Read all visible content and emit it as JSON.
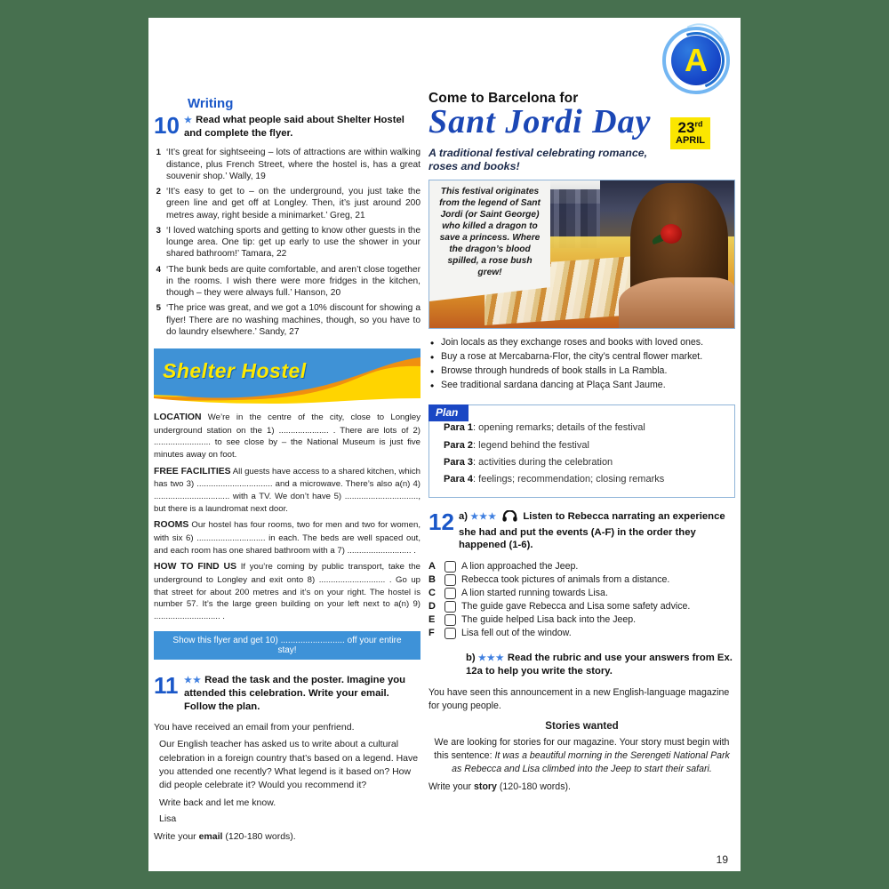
{
  "page": {
    "number": "19",
    "badge_letter": "A"
  },
  "left": {
    "section_title": "Writing",
    "ex10": {
      "number": "10",
      "stars": "★",
      "instruction": "Read what people said about Shelter Hostel and complete the flyer.",
      "items": [
        {
          "n": "1",
          "text": "‘It’s great for sightseeing – lots of attractions are within walking distance, plus French Street, where the hostel is, has a great souvenir shop.’ Wally, 19"
        },
        {
          "n": "2",
          "text": "‘It’s easy to get to – on the underground, you just take the green line and get off at Longley. Then, it’s just around 200 metres away, right beside a minimarket.’ Greg, 21"
        },
        {
          "n": "3",
          "text": "‘I loved watching sports and getting to know other guests in the lounge area. One tip: get up early to use the shower in your shared bathroom!’ Tamara, 22"
        },
        {
          "n": "4",
          "text": "‘The bunk beds are quite comfortable, and aren’t close together in the rooms. I wish there were more fridges in the kitchen, though – they were always full.’ Hanson, 20"
        },
        {
          "n": "5",
          "text": "‘The price was great, and we got a 10% discount for showing a flyer! There are no washing machines, though, so you have to do laundry elsewhere.’ Sandy, 27"
        }
      ]
    },
    "flyer": {
      "title": "Shelter Hostel",
      "location_label": "LOCATION",
      "location_text": "We’re in the centre of the city, close to Longley underground station on the 1) ..................... . There are lots of 2) ........................ to see close by – the National Museum is just five minutes away on foot.",
      "facilities_label": "FREE FACILITIES",
      "facilities_text": "All guests have access to a shared kitchen, which has two 3) ................................ and a microwave. There’s also a(n) 4) ................................ with a TV. We don’t have 5) ..............................., but there is a laundromat next door.",
      "rooms_label": "ROOMS",
      "rooms_text": "Our hostel has four rooms, two for men and two for women, with six 6) ............................. in each. The beds are well spaced out, and each room has one shared bathroom with a 7) ........................... .",
      "find_label": "HOW TO FIND US",
      "find_text": "If you’re coming by public transport, take the underground to Longley and exit onto 8) ............................ . Go up that street for about 200 metres and it’s on your right. The hostel is number 57. It’s the large green building on your left next to a(n) 9) ............................ .",
      "banner": "Show this flyer and get 10) .......................... off your entire stay!"
    },
    "ex11": {
      "number": "11",
      "stars": "★★",
      "instruction": "Read the task and the poster. Imagine you attended this celebration. Write your email. Follow the plan.",
      "intro": "You have received an email from your penfriend.",
      "body": "Our English teacher has asked us to write about a cultural celebration in a foreign country that’s based on a legend. Have you attended one recently? What legend is it based on? How did people celebrate it? Would you recommend it?",
      "signoff": "Write back and let me know.",
      "name": "Lisa",
      "task_pre": "Write your ",
      "task_bold": "email",
      "task_post": " (120-180 words)."
    }
  },
  "right": {
    "poster": {
      "kicker": "Come to Barcelona for",
      "title": "Sant Jordi Day",
      "date_day": "23",
      "date_suffix": "rd",
      "date_month": "APRIL",
      "subtitle": "A traditional festival celebrating romance, roses and books!",
      "caption": "This festival originates from the legend of Sant Jordi (or Saint George) who killed a dragon to save a princess. Where the dragon’s blood spilled, a rose bush grew!",
      "bullets": [
        "Join locals as they exchange roses and books with loved ones.",
        "Buy a rose at Mercabarna-Flor, the city’s central flower market.",
        "Browse through hundreds of book stalls in La Rambla.",
        "See traditional sardana dancing at Plaça Sant Jaume."
      ]
    },
    "plan": {
      "tab": "Plan",
      "rows": [
        {
          "label": "Para 1",
          "text": ": opening remarks; details of the festival"
        },
        {
          "label": "Para 2",
          "text": ": legend behind the festival"
        },
        {
          "label": "Para 3",
          "text": ": activities during the celebration"
        },
        {
          "label": "Para 4",
          "text": ": feelings; recommendation; closing remarks"
        }
      ]
    },
    "ex12": {
      "number": "12",
      "part_a_label": "a)",
      "stars_a": "★★★",
      "instruction_a": "Listen to Rebecca narrating an experience she had and put the events (A-F) in the order they happened (1-6).",
      "options": [
        {
          "letter": "A",
          "text": "A lion approached the Jeep."
        },
        {
          "letter": "B",
          "text": "Rebecca took pictures of animals from a distance."
        },
        {
          "letter": "C",
          "text": "A lion started running towards Lisa."
        },
        {
          "letter": "D",
          "text": "The guide gave Rebecca and Lisa some safety advice."
        },
        {
          "letter": "E",
          "text": "The guide helped Lisa back into the Jeep."
        },
        {
          "letter": "F",
          "text": "Lisa fell out of the window."
        }
      ],
      "part_b_label": "b)",
      "stars_b": "★★★",
      "instruction_b": "Read the rubric and use your answers from Ex. 12a to help you write the story.",
      "rubric_intro": "You have seen this announcement in a new English-language magazine for young people.",
      "rubric_header": "Stories wanted",
      "rubric_line1": "We are looking for stories for our magazine. Your story must begin with this sentence: ",
      "rubric_sentence": "It was a beautiful morning in the Serengeti National Park as Rebecca and Lisa climbed into the Jeep to start their safari.",
      "task_pre": "Write your ",
      "task_bold": "story",
      "task_post": " (120-180 words)."
    }
  },
  "colors": {
    "accent_blue": "#1a57c8",
    "deep_blue": "#1b47b5",
    "flyer_blue": "#2f7fc8",
    "flyer_yellow": "#ffe900",
    "badge_yellow": "#fbe600",
    "page_bg": "#47704f"
  }
}
